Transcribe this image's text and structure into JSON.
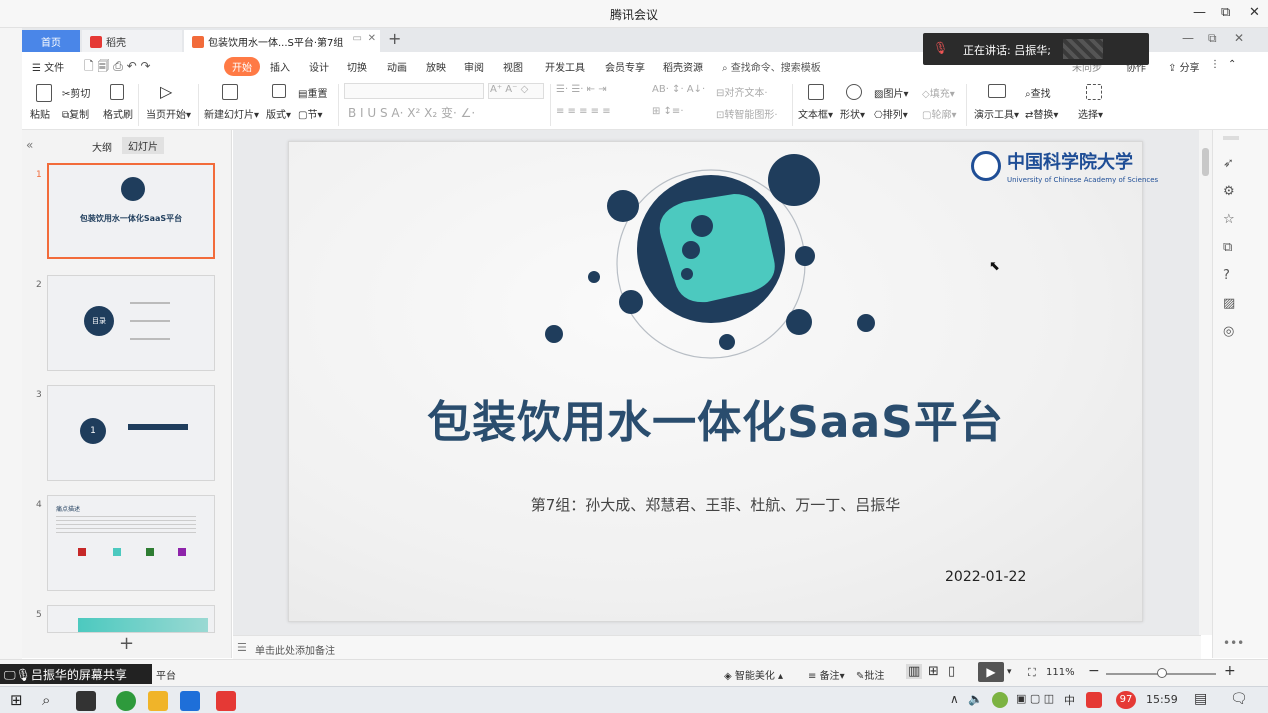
{
  "window": {
    "title": "腾讯会议",
    "controls": [
      "—",
      "⧉",
      "✕"
    ]
  },
  "tabs": {
    "home": "首页",
    "daoke": "稻壳",
    "doc": "包装饮用水一体...S平台·第7组"
  },
  "menu": [
    "文件",
    "开始",
    "插入",
    "设计",
    "切换",
    "动画",
    "放映",
    "审阅",
    "视图",
    "开发工具",
    "会员专享",
    "稻壳资源",
    "查找命令、搜索模板"
  ],
  "menu_right": {
    "collab": "协作",
    "share": "分享",
    "sync": "未同步"
  },
  "ribbon": {
    "paste": "粘贴",
    "cut": "剪切",
    "copy": "复制",
    "painter": "格式刷",
    "from_current": "当页开始",
    "new_slide": "新建幻灯片",
    "layout": "版式",
    "section": "节",
    "reset": "重置",
    "align_text": "对齐文本",
    "convert_smart": "转智能图形",
    "textbox": "文本框",
    "shape": "形状",
    "picture": "图片",
    "fill": "填充",
    "arrange": "排列",
    "outline": "轮廓",
    "presenter": "演示工具",
    "find": "查找",
    "replace": "替换",
    "select": "选择"
  },
  "panel": {
    "tab_outline": "大纲",
    "tab_slides": "幻灯片"
  },
  "thumbs": [
    {
      "num": "1",
      "title": "包装饮用水一体化SaaS平台"
    },
    {
      "num": "2",
      "title": "目录"
    },
    {
      "num": "3",
      "title": "1"
    },
    {
      "num": "4",
      "title": "痛点描述"
    },
    {
      "num": "5",
      "title": ""
    }
  ],
  "slide": {
    "title": "包装饮用水一体化SaaS平台",
    "subtitle": "第7组：孙大成、郑慧君、王菲、杜航、万一丁、吕振华",
    "date": "2022-01-22",
    "logo_cn": "中国科学院大学",
    "logo_en": "University of Chinese Academy of Sciences"
  },
  "notes_placeholder": "单击此处添加备注",
  "status": {
    "slide_name": "平台",
    "beautify": "智能美化",
    "notes": "备注",
    "comments": "批注",
    "zoom": "111%"
  },
  "meeting": {
    "speaking": "正在讲话: 吕振华;",
    "share_label": "吕振华的屏幕共享"
  },
  "taskbar": {
    "time": "15:59",
    "badge": "97",
    "ime": "中"
  },
  "colors": {
    "accent": "#f26b3a",
    "navy": "#1f3d5c",
    "teal": "#4cc9bf",
    "brand_blue": "#4a86e8"
  }
}
